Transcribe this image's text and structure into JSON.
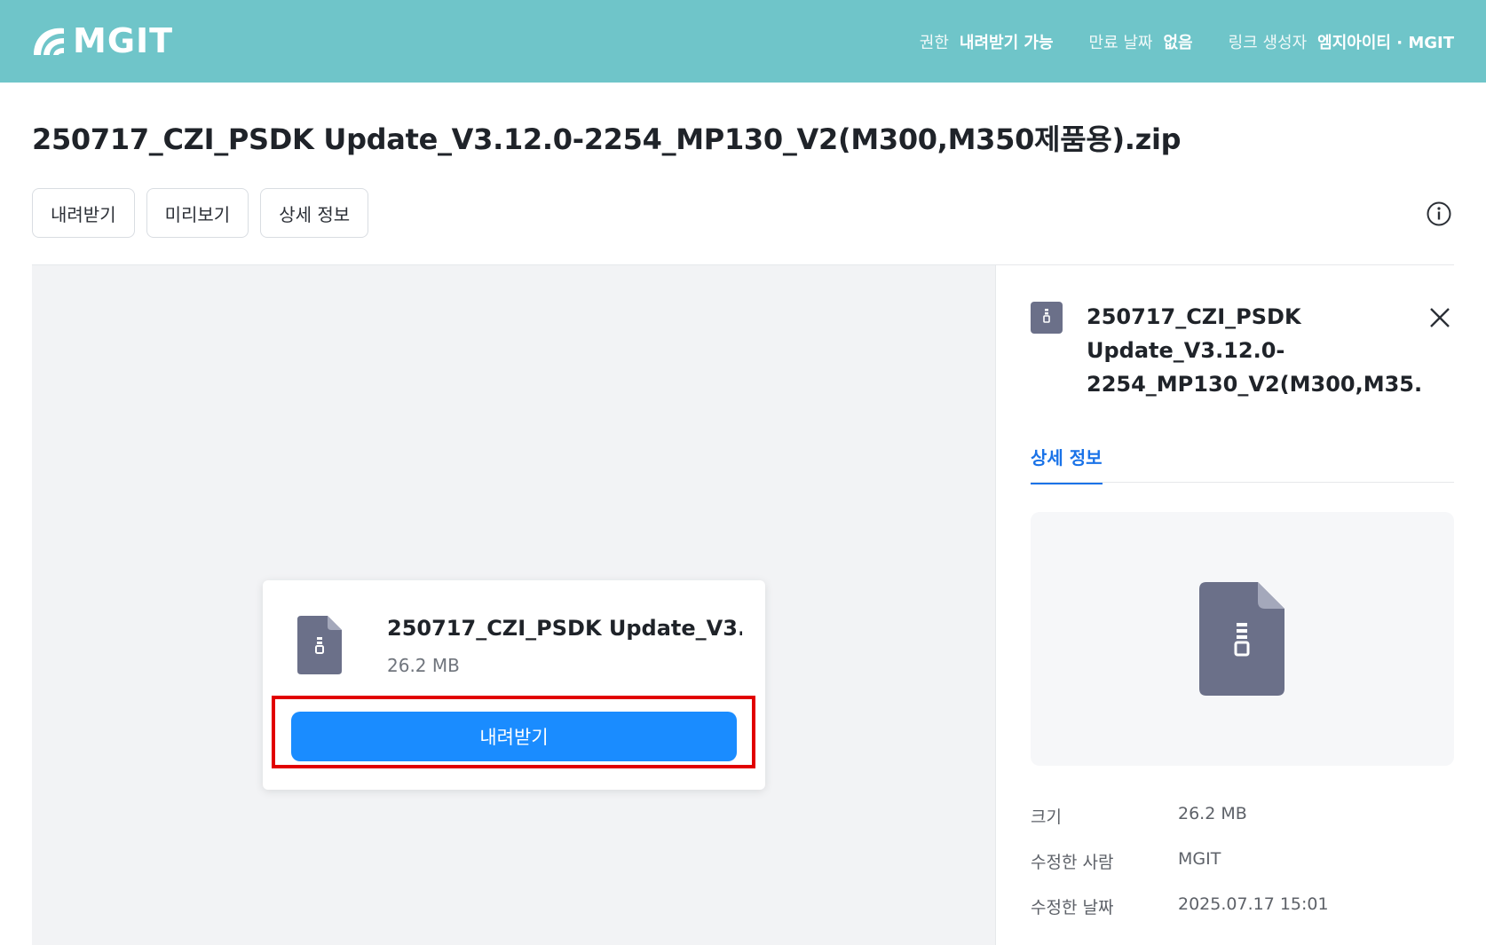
{
  "header": {
    "logo_text": "MGIT",
    "meta": [
      {
        "key": "권한",
        "value": "내려받기 가능"
      },
      {
        "key": "만료 날짜",
        "value": "없음"
      },
      {
        "key": "링크 생성자",
        "value": "엠지아이티 · MGIT"
      }
    ],
    "bg_color": "#6fc5c9"
  },
  "file": {
    "title": "250717_CZI_PSDK Update_V3.12.0-2254_MP130_V2(M300,M350제품용).zip"
  },
  "actions": {
    "download_label": "내려받기",
    "preview_label": "미리보기",
    "details_label": "상세 정보",
    "info_icon": "info-icon"
  },
  "card": {
    "name": "250717_CZI_PSDK Update_V3.1...",
    "size": "26.2 MB",
    "download_button": "내려받기",
    "accent_color": "#1a8cff",
    "highlight_color": "#e10000"
  },
  "panel": {
    "title_lines": [
      "250717_CZI_PSDK",
      "Update_V3.12.0-",
      "2254_MP130_V2(M300,M35..."
    ],
    "tab_label": "상세 정보",
    "properties": [
      {
        "key": "크기",
        "value": "26.2 MB"
      },
      {
        "key": "수정한 사람",
        "value": "MGIT"
      },
      {
        "key": "수정한 날짜",
        "value": "2025.07.17 15:01"
      }
    ]
  }
}
